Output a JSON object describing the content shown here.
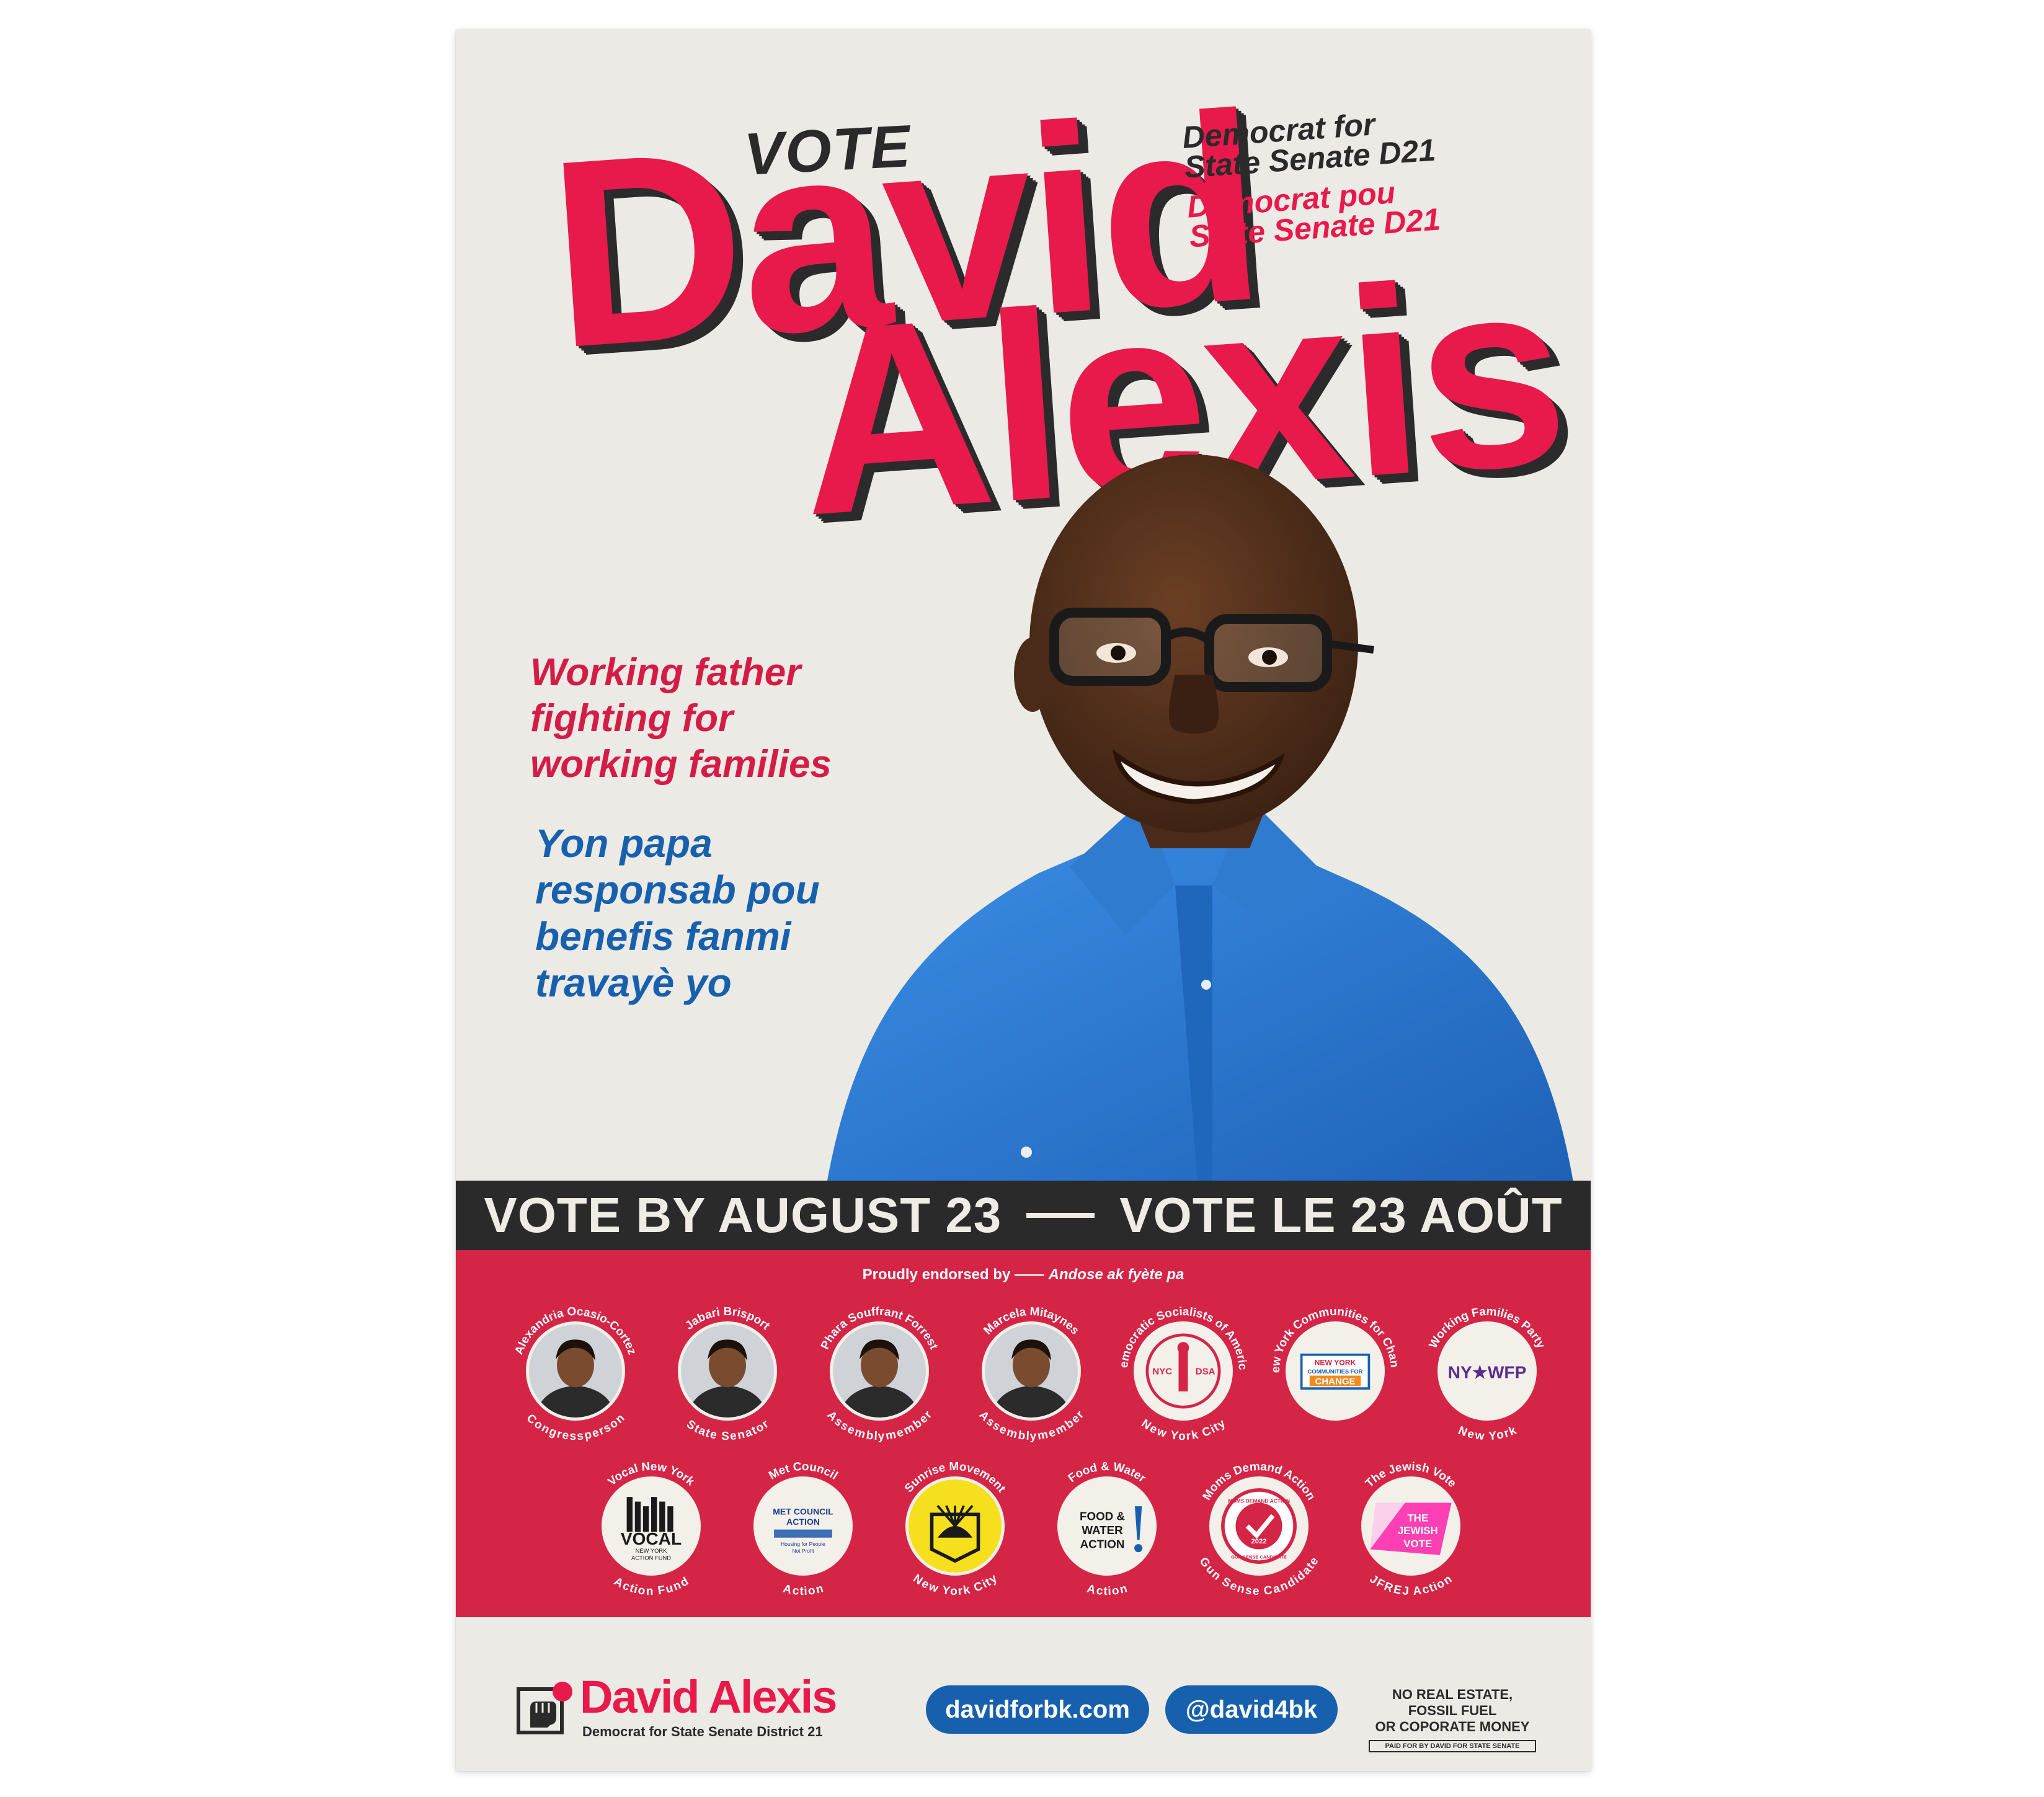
{
  "headline": {
    "vote": "VOTE",
    "first_name": "David",
    "last_name": "Alexis",
    "office_en_line1": "Democrat for",
    "office_en_line2": "State Senate D21",
    "office_ht_line1": "Democrat pou",
    "office_ht_line2": "State Senate D21"
  },
  "tagline": {
    "en": [
      "Working father",
      "fighting for",
      "working families"
    ],
    "ht": [
      "Yon papa",
      "responsab pou",
      "benefis fanmi",
      "travayè yo"
    ]
  },
  "banner": {
    "en": "VOTE BY AUGUST 23",
    "ht": "VOTE LE 23 AOÛT"
  },
  "endorsements": {
    "title_en": "Proudly endorsed by",
    "title_sep": "——",
    "title_ht": "Andose ak fyète pa",
    "row1": [
      {
        "top": "Alexandria Ocasio-Cortez",
        "bottom": "Congressperson",
        "kind": "person"
      },
      {
        "top": "Jabari Brisport",
        "bottom": "State Senator",
        "kind": "person"
      },
      {
        "top": "Phara Souffrant Forrest",
        "bottom": "Assemblymember",
        "kind": "person"
      },
      {
        "top": "Marcela Mitaynes",
        "bottom": "Assemblymember",
        "kind": "person"
      },
      {
        "top": "Democratic Socialists of America",
        "bottom": "New York City",
        "kind": "dsa",
        "logo_left": "NYC",
        "logo_right": "DSA"
      },
      {
        "top": "New York Communities for Change",
        "bottom": "",
        "kind": "nycc",
        "logo_line1": "NEW YORK",
        "logo_line2": "COMMUNITIES FOR",
        "logo_line3": "CHANGE"
      },
      {
        "top": "Working Families Party",
        "bottom": "New York",
        "kind": "wfp",
        "logo_text": "NY★WFP"
      }
    ],
    "row2": [
      {
        "top": "Vocal New York",
        "bottom": "Action Fund",
        "kind": "vocal",
        "logo_line1": "VOCAL",
        "logo_line2": "NEW YORK",
        "logo_line3": "ACTION FUND"
      },
      {
        "top": "Met Council",
        "bottom": "Action",
        "kind": "met",
        "logo_line1": "MET COUNCIL",
        "logo_line2": "ACTION",
        "logo_line3": "Housing for People",
        "logo_line4": "Not Profit"
      },
      {
        "top": "Sunrise Movement",
        "bottom": "New York City",
        "kind": "sunrise"
      },
      {
        "top": "Food & Water",
        "bottom": "Action",
        "kind": "fwa",
        "logo_line1": "FOOD &",
        "logo_line2": "WATER",
        "logo_line3": "ACTION"
      },
      {
        "top": "Moms Demand Action",
        "bottom": "Gun Sense Candidate",
        "kind": "moms",
        "logo_line1": "MOMS DEMAND ACTION",
        "logo_line2": "2022",
        "logo_line3": "GUN SENSE CANDIDATE"
      },
      {
        "top": "The Jewish Vote",
        "bottom": "JFREJ Action",
        "kind": "jewish",
        "logo_line1": "THE",
        "logo_line2": "JEWISH",
        "logo_line3": "VOTE"
      }
    ]
  },
  "footer": {
    "name": "David Alexis",
    "subtitle": "Democrat for State Senate District 21",
    "website": "davidforbk.com",
    "handle": "@david4bk",
    "disclaimer_line1": "NO REAL ESTATE, FOSSIL FUEL",
    "disclaimer_line2": "OR COPORATE MONEY",
    "paid_for": "PAID FOR BY DAVID FOR STATE SENATE"
  },
  "colors": {
    "background": "#eceae5",
    "red": "#e8194b",
    "panel_red": "#d42546",
    "dark": "#2a2a2a",
    "blue": "#1760ad",
    "shirt_blue": "#2a7fd6"
  }
}
